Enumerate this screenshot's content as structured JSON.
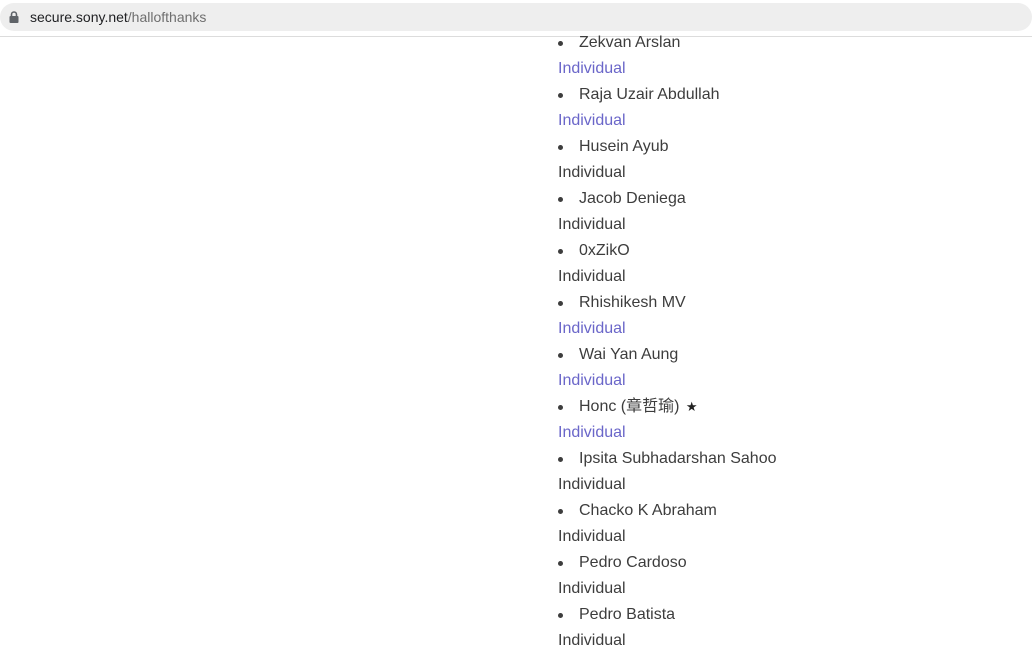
{
  "browser": {
    "url_host": "secure.sony.net",
    "url_path": "/hallofthanks"
  },
  "colors": {
    "link_type": "#6a66c9",
    "plain_type": "#3d3d3d"
  },
  "entries": [
    {
      "name": "Zekvan Arslan",
      "type": "Individual",
      "linked": true
    },
    {
      "name": "Raja Uzair Abdullah",
      "type": "Individual",
      "linked": true
    },
    {
      "name": "Husein Ayub",
      "type": "Individual",
      "linked": false
    },
    {
      "name": "Jacob Deniega",
      "type": "Individual",
      "linked": false
    },
    {
      "name": "0xZikO",
      "type": "Individual",
      "linked": false
    },
    {
      "name": "Rhishikesh MV",
      "type": "Individual",
      "linked": true
    },
    {
      "name": "Wai Yan Aung",
      "type": "Individual",
      "linked": true
    },
    {
      "name": "Honc (章哲瑜)",
      "type": "Individual",
      "linked": true,
      "star": "★"
    },
    {
      "name": "Ipsita Subhadarshan Sahoo",
      "type": "Individual",
      "linked": false
    },
    {
      "name": "Chacko K Abraham",
      "type": "Individual",
      "linked": false
    },
    {
      "name": "Pedro Cardoso",
      "type": "Individual",
      "linked": false
    },
    {
      "name": "Pedro Batista",
      "type": "Individual",
      "linked": false
    }
  ]
}
